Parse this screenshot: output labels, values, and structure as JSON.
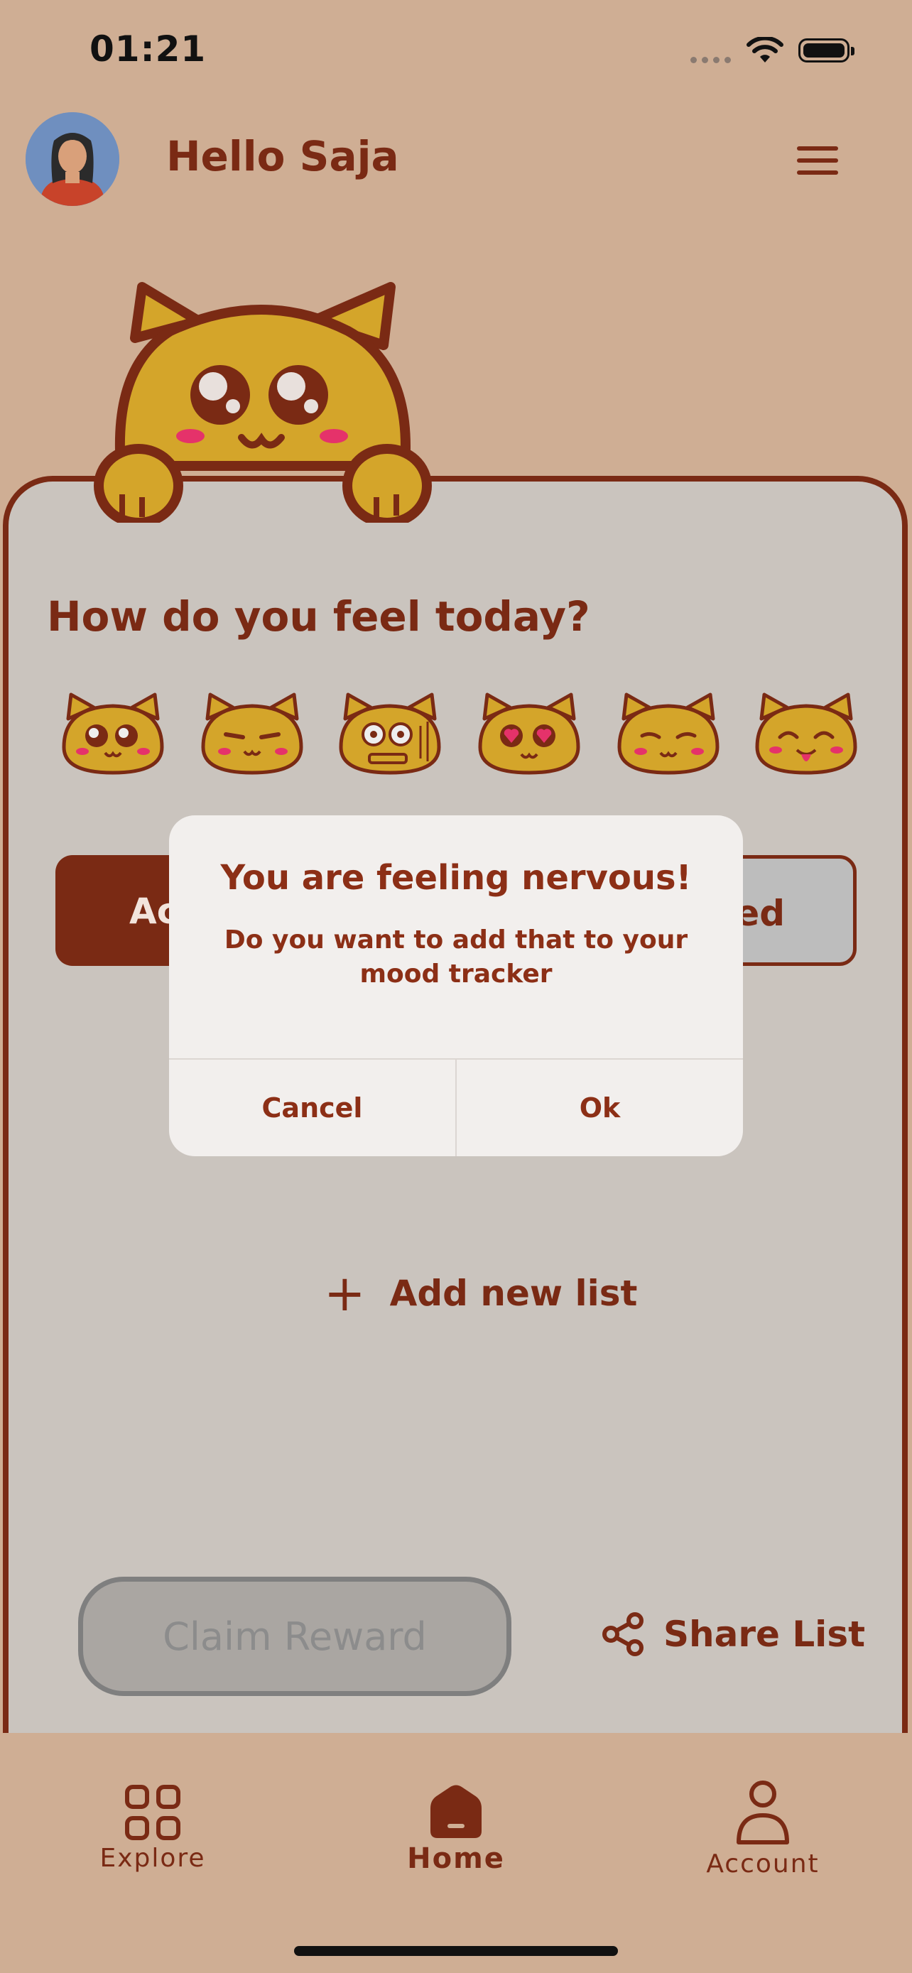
{
  "status_bar": {
    "time": "01:21"
  },
  "header": {
    "greeting": "Hello Saja"
  },
  "mood": {
    "title": "How do you feel today?",
    "emojis": [
      "happy",
      "content",
      "nervous",
      "love",
      "sad",
      "playful"
    ]
  },
  "tabs": {
    "active_fragment": "Ac",
    "done_fragment": "ed"
  },
  "actions": {
    "add_list": "Add new list",
    "claim_reward": "Claim Reward",
    "share_list": "Share List"
  },
  "dialog": {
    "title": "You are feeling nervous!",
    "message": "Do you want to add that to your mood tracker",
    "cancel": "Cancel",
    "ok": "Ok"
  },
  "nav": {
    "explore": "Explore",
    "home": "Home",
    "account": "Account"
  },
  "colors": {
    "background": "#cfae94",
    "accent": "#7a2a14",
    "card": "#cac4be",
    "mascot": "#d4a52a"
  }
}
